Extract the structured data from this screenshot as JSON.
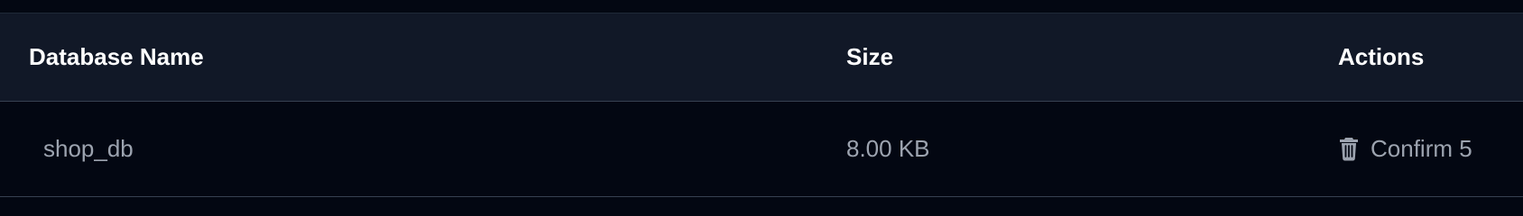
{
  "table": {
    "headers": {
      "name": "Database Name",
      "size": "Size",
      "actions": "Actions"
    },
    "rows": [
      {
        "name": "shop_db",
        "size": "8.00 KB",
        "action_label": "Confirm 5",
        "action_icon": "trash-icon"
      }
    ]
  },
  "colors": {
    "page_background": "#030712",
    "header_background": "#111827",
    "header_text": "#ffffff",
    "cell_text": "#9ca3af",
    "divider": "#374151"
  }
}
